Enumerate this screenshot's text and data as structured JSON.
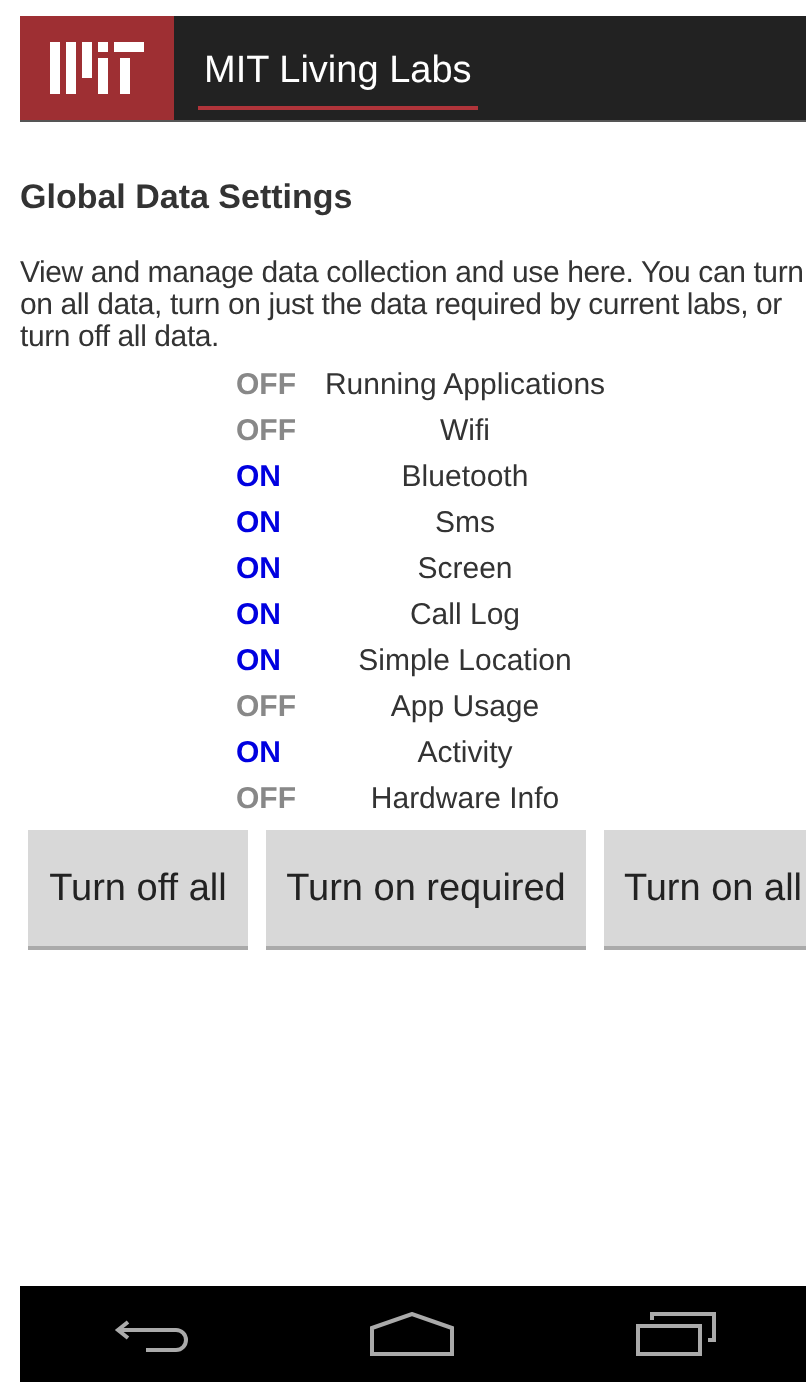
{
  "action_bar": {
    "title": "MIT Living Labs"
  },
  "heading": "Global Data Settings",
  "description": "View and manage data collection and use here. You can turn on all data, turn on just the data required by current labs, or turn off all data.",
  "settings": [
    {
      "status": "OFF",
      "on": false,
      "name": "Running Applications"
    },
    {
      "status": "OFF",
      "on": false,
      "name": "Wifi"
    },
    {
      "status": "ON",
      "on": true,
      "name": "Bluetooth"
    },
    {
      "status": "ON",
      "on": true,
      "name": "Sms"
    },
    {
      "status": "ON",
      "on": true,
      "name": "Screen"
    },
    {
      "status": "ON",
      "on": true,
      "name": "Call Log"
    },
    {
      "status": "ON",
      "on": true,
      "name": "Simple Location"
    },
    {
      "status": "OFF",
      "on": false,
      "name": "App Usage"
    },
    {
      "status": "ON",
      "on": true,
      "name": "Activity"
    },
    {
      "status": "OFF",
      "on": false,
      "name": "Hardware Info"
    }
  ],
  "buttons": [
    "Turn off all",
    "Turn on required",
    "Turn on all"
  ]
}
